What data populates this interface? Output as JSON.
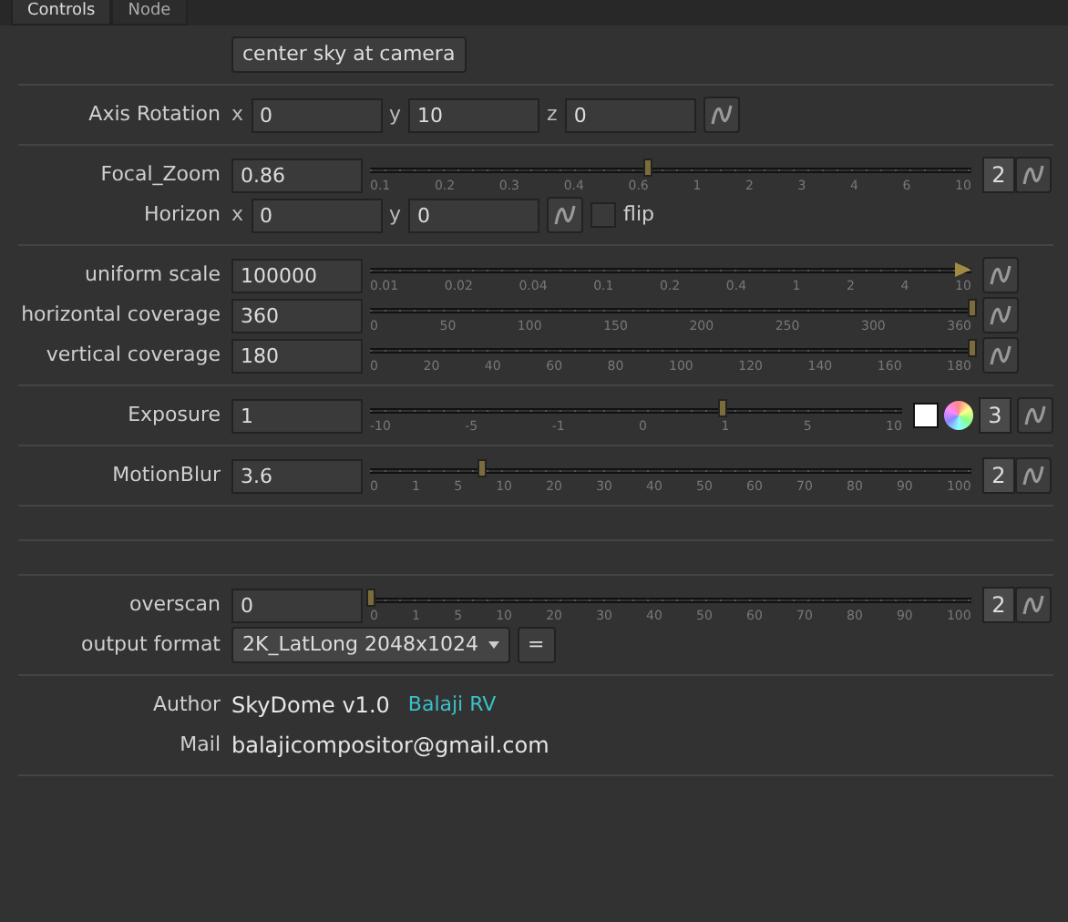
{
  "tabs": [
    {
      "label": "Controls",
      "selected": true
    },
    {
      "label": "Node",
      "selected": false
    }
  ],
  "sections": [
    {
      "kind": "rows",
      "rows": [
        {
          "kind": "button",
          "label": "center sky at camera"
        }
      ]
    },
    {
      "kind": "rows",
      "rows": [
        {
          "kind": "xyz",
          "label": "Axis Rotation",
          "fields": [
            {
              "axis": "x",
              "value": "0"
            },
            {
              "axis": "y",
              "value": "10"
            },
            {
              "axis": "z",
              "value": "0"
            }
          ]
        }
      ]
    },
    {
      "kind": "rows",
      "rows": [
        {
          "kind": "slider",
          "label": "Focal_Zoom",
          "value": "0.86",
          "level": 0.46,
          "overflow": false,
          "color_controls": false,
          "views": "2",
          "ticks": [
            "0.1",
            "0.2",
            "0.3",
            "0.4",
            "0.6",
            "1",
            "2",
            "3",
            "4",
            "6",
            "10"
          ]
        },
        {
          "kind": "xy",
          "label": "Horizon",
          "fields": [
            {
              "axis": "x",
              "value": "0"
            },
            {
              "axis": "y",
              "value": "0"
            }
          ],
          "checkbox": {
            "label": "flip",
            "checked": false
          }
        }
      ]
    },
    {
      "kind": "rows",
      "rows": [
        {
          "kind": "slider",
          "label": "uniform scale",
          "value": "100000",
          "level": 1,
          "overflow": true,
          "color_controls": false,
          "ticks": [
            "0.01",
            "0.02",
            "0.04",
            "0.1",
            "0.2",
            "0.4",
            "1",
            "2",
            "4",
            "10"
          ]
        },
        {
          "kind": "slider",
          "label": "horizontal coverage",
          "value": "360",
          "level": 1,
          "overflow": false,
          "color_controls": false,
          "ticks": [
            "0",
            "50",
            "100",
            "150",
            "200",
            "250",
            "300",
            "360"
          ]
        },
        {
          "kind": "slider",
          "label": "vertical coverage",
          "value": "180",
          "level": 1,
          "overflow": false,
          "color_controls": false,
          "ticks": [
            "0",
            "20",
            "40",
            "60",
            "80",
            "100",
            "120",
            "140",
            "160",
            "180"
          ]
        }
      ]
    },
    {
      "kind": "rows",
      "rows": [
        {
          "kind": "slider",
          "label": "Exposure",
          "value": "1",
          "level": 0.66,
          "overflow": false,
          "color_controls": true,
          "views": "3",
          "ticks": [
            "-10",
            "-5",
            "-1",
            "0",
            "1",
            "5",
            "10"
          ]
        }
      ]
    },
    {
      "kind": "rows",
      "rows": [
        {
          "kind": "slider",
          "label": "MotionBlur",
          "value": "3.6",
          "level": 0.185,
          "overflow": false,
          "color_controls": false,
          "views": "2",
          "ticks": [
            "0",
            "1",
            "5",
            "10",
            "20",
            "30",
            "40",
            "50",
            "60",
            "70",
            "80",
            "90",
            "100"
          ]
        }
      ]
    },
    {
      "kind": "empty"
    },
    {
      "kind": "empty"
    },
    {
      "kind": "rows",
      "rows": [
        {
          "kind": "slider",
          "label": "overscan",
          "value": "0",
          "level": 0,
          "overflow": false,
          "color_controls": false,
          "views": "2",
          "ticks": [
            "0",
            "1",
            "5",
            "10",
            "20",
            "30",
            "40",
            "50",
            "60",
            "70",
            "80",
            "90",
            "100"
          ]
        },
        {
          "kind": "dropdown",
          "label": "output format",
          "value": "2K_LatLong 2048x1024",
          "button": "="
        }
      ]
    },
    {
      "kind": "rows",
      "rows": [
        {
          "kind": "info",
          "label": "Author",
          "value": "SkyDome v1.0",
          "link": "Balaji RV"
        },
        {
          "kind": "info",
          "label": "Mail",
          "value": "balajicompositor@gmail.com"
        }
      ]
    }
  ]
}
